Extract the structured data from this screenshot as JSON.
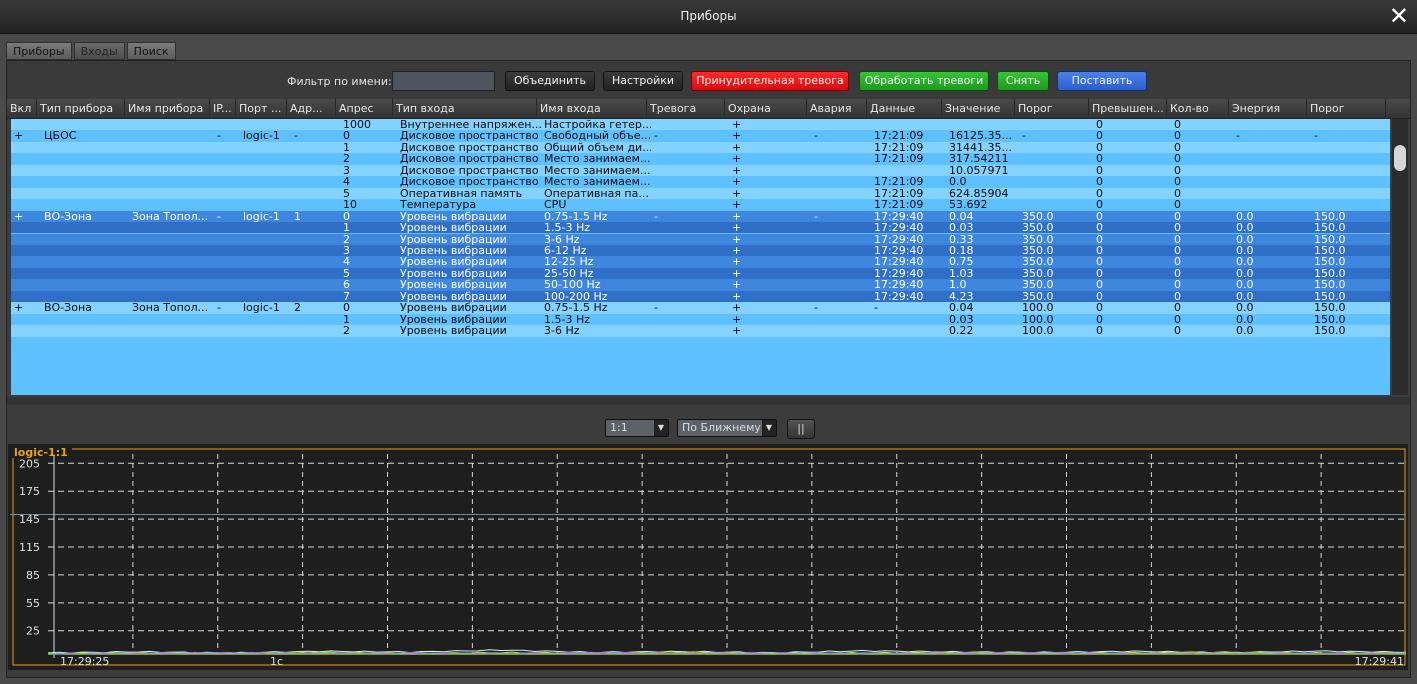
{
  "window": {
    "title": "Приборы",
    "close_label": "✕"
  },
  "tabs": [
    "Приборы",
    "Входы",
    "Поиск"
  ],
  "filter": {
    "label": "Фильтр по имени:",
    "value": ""
  },
  "buttons": {
    "merge": "Объединить",
    "settings": "Настройки",
    "force_alarm": "Принудительная тревога",
    "process_alarms": "Обработать тревоги",
    "disarm": "Снять",
    "arm": "Поставить"
  },
  "colors": {
    "row_light": "#84d2ff",
    "row_light_alt": "#5fc0ff",
    "row_dark": "#3f86de",
    "row_dark_alt": "#2f6fc7",
    "accent": "#e8a317"
  },
  "columns": [
    "Вкл",
    "Тип прибора",
    "Имя прибора",
    "IP...",
    "Порт ...",
    "Адр...",
    "Апрес",
    "Тип входа",
    "Имя входа",
    "Тревога",
    "Охрана",
    "Авария",
    "Данные",
    "Значение",
    "Порог",
    "Превышен...",
    "Кол-во",
    "Энергия",
    "Порог"
  ],
  "rows": [
    {
      "cells": [
        "",
        "",
        "",
        "",
        "",
        "",
        "1000",
        "Внутреннее напряжен...",
        "Настройка гетер...",
        "",
        "+",
        "",
        "",
        "",
        "",
        "0",
        "0",
        "",
        ""
      ]
    },
    {
      "cells": [
        "+",
        "ЦБОС",
        "",
        "-",
        "logic-1",
        "-",
        "0",
        "Дисковое пространство",
        "Свободный объе...",
        "-",
        "+",
        "-",
        "17:21:09",
        "16125.35...",
        "-",
        "0",
        "0",
        "-",
        "-"
      ]
    },
    {
      "cells": [
        "",
        "",
        "",
        "",
        "",
        "",
        "1",
        "Дисковое пространство",
        "Общий объем ди...",
        "",
        "+",
        "",
        "17:21:09",
        "31441.35...",
        "",
        "0",
        "0",
        "",
        ""
      ]
    },
    {
      "cells": [
        "",
        "",
        "",
        "",
        "",
        "",
        "2",
        "Дисковое пространство",
        "Место занимаем...",
        "",
        "+",
        "",
        "17:21:09",
        "317.54211",
        "",
        "0",
        "0",
        "",
        ""
      ]
    },
    {
      "cells": [
        "",
        "",
        "",
        "",
        "",
        "",
        "3",
        "Дисковое пространство",
        "Место занимаем...",
        "",
        "+",
        "",
        "",
        "10.057971",
        "",
        "0",
        "0",
        "",
        ""
      ]
    },
    {
      "cells": [
        "",
        "",
        "",
        "",
        "",
        "",
        "4",
        "Дисковое пространство",
        "Место занимаем...",
        "",
        "+",
        "",
        "17:21:09",
        "0.0",
        "",
        "0",
        "0",
        "",
        ""
      ]
    },
    {
      "cells": [
        "",
        "",
        "",
        "",
        "",
        "",
        "5",
        "Оперативная память",
        "Оперативная па...",
        "",
        "+",
        "",
        "17:21:09",
        "624.85904",
        "",
        "0",
        "0",
        "",
        ""
      ]
    },
    {
      "cells": [
        "",
        "",
        "",
        "",
        "",
        "",
        "10",
        "Температура",
        "CPU",
        "",
        "+",
        "",
        "17:21:09",
        "53.692",
        "",
        "0",
        "0",
        "",
        ""
      ]
    },
    {
      "cells": [
        "+",
        "ВО-Зона",
        "Зона Топол...",
        "-",
        "logic-1",
        "1",
        "0",
        "Уровень вибрации",
        "0.75-1.5 Hz",
        "-",
        "+",
        "-",
        "17:29:40",
        "0.04",
        "350.0",
        "0",
        "0",
        "0.0",
        "150.0"
      ]
    },
    {
      "cells": [
        "",
        "",
        "",
        "",
        "",
        "",
        "1",
        "Уровень вибрации",
        "1.5-3 Hz",
        "",
        "+",
        "",
        "17:29:40",
        "0.03",
        "350.0",
        "0",
        "0",
        "0.0",
        "150.0"
      ]
    },
    {
      "cells": [
        "",
        "",
        "",
        "",
        "",
        "",
        "2",
        "Уровень вибрации",
        "3-6 Hz",
        "",
        "+",
        "",
        "17:29:40",
        "0.33",
        "350.0",
        "0",
        "0",
        "0.0",
        "150.0"
      ]
    },
    {
      "cells": [
        "",
        "",
        "",
        "",
        "",
        "",
        "3",
        "Уровень вибрации",
        "6-12 Hz",
        "",
        "+",
        "",
        "17:29:40",
        "0.18",
        "350.0",
        "0",
        "0",
        "0.0",
        "150.0"
      ]
    },
    {
      "cells": [
        "",
        "",
        "",
        "",
        "",
        "",
        "4",
        "Уровень вибрации",
        "12-25 Hz",
        "",
        "+",
        "",
        "17:29:40",
        "0.75",
        "350.0",
        "0",
        "0",
        "0.0",
        "150.0"
      ]
    },
    {
      "cells": [
        "",
        "",
        "",
        "",
        "",
        "",
        "5",
        "Уровень вибрации",
        "25-50 Hz",
        "",
        "+",
        "",
        "17:29:40",
        "1.03",
        "350.0",
        "0",
        "0",
        "0.0",
        "150.0"
      ]
    },
    {
      "cells": [
        "",
        "",
        "",
        "",
        "",
        "",
        "6",
        "Уровень вибрации",
        "50-100 Hz",
        "",
        "+",
        "",
        "17:29:40",
        "1.0",
        "350.0",
        "0",
        "0",
        "0.0",
        "150.0"
      ]
    },
    {
      "cells": [
        "",
        "",
        "",
        "",
        "",
        "",
        "7",
        "Уровень вибрации",
        "100-200 Hz",
        "",
        "+",
        "",
        "17:29:40",
        "4.23",
        "350.0",
        "0",
        "0",
        "0.0",
        "150.0"
      ]
    },
    {
      "cells": [
        "+",
        "ВО-Зона",
        "Зона Топол...",
        "-",
        "logic-1",
        "2",
        "0",
        "Уровень вибрации",
        "0.75-1.5 Hz",
        "-",
        "+",
        "-",
        "-",
        "0.04",
        "100.0",
        "0",
        "0",
        "0.0",
        "150.0"
      ]
    },
    {
      "cells": [
        "",
        "",
        "",
        "",
        "",
        "",
        "1",
        "Уровень вибрации",
        "1.5-3 Hz",
        "",
        "+",
        "",
        "",
        "0.03",
        "100.0",
        "0",
        "0",
        "0.0",
        "150.0"
      ]
    },
    {
      "cells": [
        "",
        "",
        "",
        "",
        "",
        "",
        "2",
        "Уровень вибрации",
        "3-6 Hz",
        "",
        "+",
        "",
        "",
        "0.22",
        "100.0",
        "0",
        "0",
        "0.0",
        "150.0"
      ]
    }
  ],
  "row_groups": [
    "light",
    "light",
    "light",
    "light",
    "light",
    "light",
    "light",
    "light",
    "dark",
    "dark",
    "dark",
    "dark",
    "dark",
    "dark",
    "dark",
    "dark",
    "light",
    "light",
    "light"
  ],
  "chart_toolbar": {
    "scale_value": "1:1",
    "interp_value": "По Ближнему",
    "pause_label": "||"
  },
  "chart_data": {
    "type": "line",
    "title": "logic-1:1",
    "x_start_label": "17:29:25",
    "x_end_label": "17:29:41",
    "x_scale_label": "1с",
    "y_ticks": [
      205,
      175,
      145,
      115,
      85,
      55,
      25
    ],
    "ylim": [
      0,
      215
    ],
    "grid": true,
    "threshold": 150,
    "series": [
      {
        "color": "#e8e8e8",
        "values": [
          1.2,
          2.4,
          1.1,
          3.0,
          2.1,
          4.2,
          1.8,
          2.6,
          1.3,
          3.4,
          2.2,
          1.7,
          2.9,
          1.4,
          3.1,
          2.0
        ]
      },
      {
        "color": "#e8e000",
        "values": [
          0.6,
          1.2,
          0.9,
          1.8,
          0.7,
          1.5,
          1.0,
          2.0,
          0.8,
          1.1,
          1.6,
          0.9,
          1.3,
          1.9,
          1.0,
          1.4
        ]
      },
      {
        "color": "#e040e0",
        "values": [
          0.3,
          0.8,
          1.5,
          0.6,
          1.1,
          0.5,
          1.4,
          0.7,
          1.2,
          0.6,
          0.9,
          1.3,
          0.5,
          1.0,
          0.8,
          0.6
        ]
      },
      {
        "color": "#30d0d0",
        "values": [
          0.2,
          0.5,
          0.3,
          0.9,
          0.4,
          0.7,
          0.3,
          0.6,
          0.5,
          0.8,
          0.3,
          0.6,
          0.4,
          0.7,
          0.5,
          0.4
        ]
      }
    ]
  }
}
